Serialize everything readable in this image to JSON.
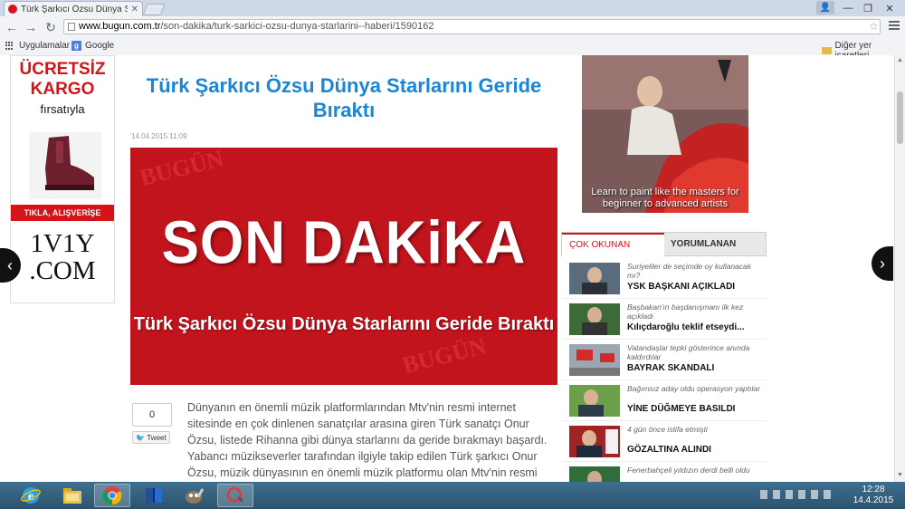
{
  "browser": {
    "tab_title": "Türk Şarkıcı Özsu Dünya S",
    "url_domain": "www.bugun.com.tr",
    "url_path": "/son-dakika/turk-sarkici-ozsu-dunya-starlarini--haberi/1590162",
    "bookmarks": {
      "apps": "Uygulamalar",
      "google": "Google",
      "other": "Diğer yer işaretleri"
    }
  },
  "left_ad": {
    "line1": "ÜCRETSİZ",
    "line2": "KARGO",
    "line3": "fırsatıyla",
    "cta": "TIKLA, ALIŞVERİŞE BAŞLA!",
    "brand": "1V1Y\n.COM"
  },
  "article": {
    "title": "Türk Şarkıcı Özsu Dünya Starlarını Geride Bıraktı",
    "date": "14.04.2015 11:09",
    "banner_main": "SON DAKiKA",
    "banner_bg": "BUGÜN",
    "banner_sub": "Türk Şarkıcı Özsu Dünya Starlarını Geride Bıraktı",
    "share_count": "0",
    "tweet_label": "Tweet",
    "body": "Dünyanın en önemli müzik platformlarından Mtv'nin resmi internet sitesinde en çok dinlenen sanatçılar arasına giren Türk sanatçı Onur Özsu, listede Rihanna gibi dünya starlarını da geride bırakmayı başardı. Yabancı müzikseverler tarafından ilgiyle takip edilen Türk şarkıcı Onur Özsu, müzik dünyasının en önemli müzik platformu olan Mtv'nin resmi"
  },
  "right_ad": {
    "text": "Learn to paint like the masters for beginner to advanced artists"
  },
  "tabs": {
    "active": "ÇOK OKUNAN",
    "inactive": "YORUMLANAN"
  },
  "news": [
    {
      "sub": "Suriyeliler de seçimde oy kullanacak mı?",
      "head": "YSK BAŞKANI AÇIKLADI"
    },
    {
      "sub": "Başbakan'ın başdanışmanı ilk kez açıkladı",
      "head": "Kılıçdaroğlu teklif etseydi..."
    },
    {
      "sub": "Vatandaşlar tepki gösterince anında kaldırdılar",
      "head": "BAYRAK SKANDALI"
    },
    {
      "sub": "Bağımsız aday oldu operasyon yaptılar",
      "head": "YİNE DÜĞMEYE BASILDI"
    },
    {
      "sub": "4 gün önce istifa etmişti",
      "head": "GÖZALTINA ALINDI"
    },
    {
      "sub": "Fenerbahçeli yıldızın derdi belli oldu",
      "head": ""
    }
  ],
  "taskbar": {
    "time": "12:28",
    "date": "14.4.2015"
  },
  "colors": {
    "accent_blue": "#1c86d6",
    "accent_red": "#d5141a"
  }
}
